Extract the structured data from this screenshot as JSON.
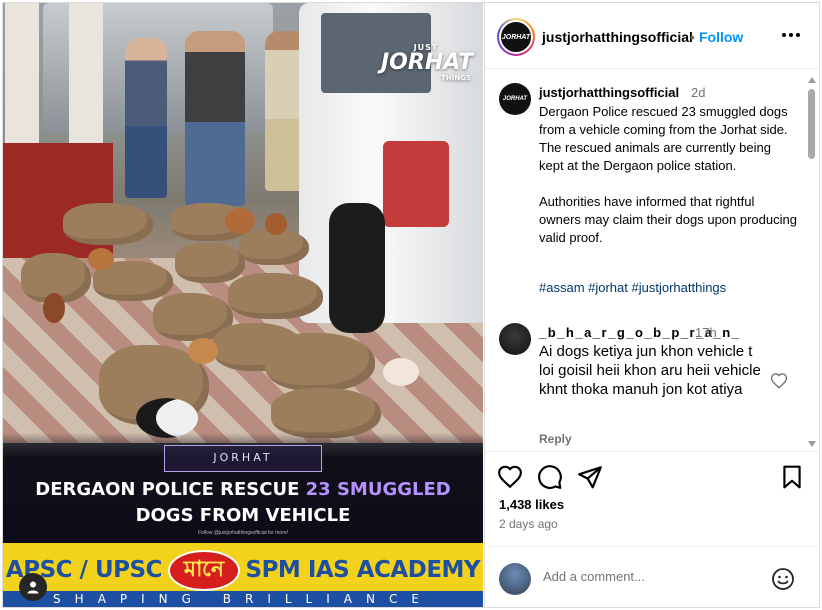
{
  "post": {
    "username": "justjorhatthingsofficial",
    "follow_label": "Follow",
    "dot": "•",
    "avatar_text": "JORHAT"
  },
  "media": {
    "watermark_top": "JUST",
    "watermark_main": "JORHAT",
    "watermark_bottom": "THINGS",
    "tag": "JORHAT",
    "headline_line1_a": "DERGAON POLICE RESCUE ",
    "headline_line1_b": "23 SMUGGLED",
    "headline_line2": "DOGS FROM VEHICLE",
    "follow_line": "Follow @justjorhatthingsofficial for more!",
    "ad_left": "APSC / UPSC",
    "ad_mid": "মানে",
    "ad_right": "SPM IAS ACADEMY",
    "ad_bottom": "SHAPING BRILLIANCE"
  },
  "caption": {
    "username": "justjorhatthingsofficial",
    "time": "2d",
    "paragraph1": "Dergaon Police rescued 23 smuggled dogs from a vehicle coming from the Jorhat side. The rescued animals are currently being kept at the Dergaon police station.",
    "paragraph2": "Authorities have informed that rightful owners may claim their dogs upon producing valid proof.",
    "hashtags": "#assam #jorhat #justjorhatthings"
  },
  "comment": {
    "username": "_b_h_a_r_g_o_b_p_r_a_n_",
    "time": "17h",
    "text": "Ai dogs ketiya jun khon vehicle t loi goisil heii khon aru heii vehicle khnt thoka manuh jon kot atiya",
    "reply_label": "Reply"
  },
  "stats": {
    "likes": "1,438 likes",
    "date": "2 days ago"
  },
  "add_comment": {
    "placeholder": "Add a comment..."
  },
  "icons": {
    "more": "more-options-icon",
    "like": "heart-icon",
    "comment": "comment-icon",
    "share": "share-icon",
    "save": "bookmark-icon",
    "emoji": "emoji-icon"
  },
  "colors": {
    "link_blue": "#0095f6",
    "hashtag": "#00376b",
    "muted": "#737373",
    "headline_accent": "#b592ff",
    "ad_yellow": "#f2d21a",
    "ad_blue": "#1d4fa3",
    "ad_red": "#d61e1e"
  }
}
